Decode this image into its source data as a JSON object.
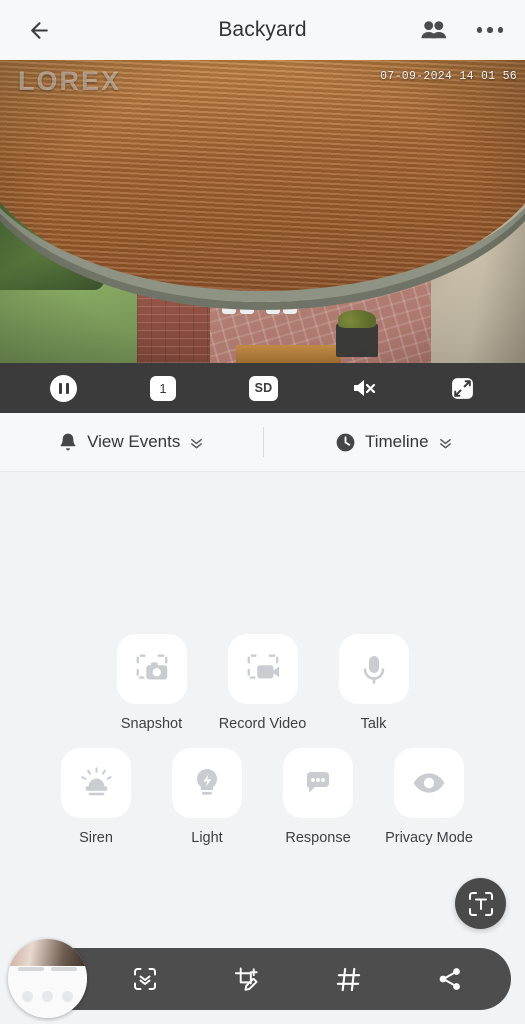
{
  "header": {
    "back_icon": "arrow-left-icon",
    "title": "Backyard",
    "people_icon": "people-icon",
    "more_icon": "more-options-icon"
  },
  "video": {
    "watermark": "LOREX",
    "timestamp": "07-09-2024 14 01 56",
    "scene_description": "Backyard patio fisheye camera view with two people"
  },
  "player_controls": {
    "pause_label": "Pause",
    "channel_label": "1",
    "quality_label": "SD",
    "mute_label": "Muted",
    "fullscreen_label": "Fullscreen"
  },
  "tabs": [
    {
      "label": "View Events",
      "icon": "bell-icon"
    },
    {
      "label": "Timeline",
      "icon": "clock-icon"
    }
  ],
  "actions": [
    [
      {
        "label": "Snapshot",
        "icon": "snapshot-icon"
      },
      {
        "label": "Record Video",
        "icon": "record-video-icon"
      },
      {
        "label": "Talk",
        "icon": "microphone-icon"
      }
    ],
    [
      {
        "label": "Siren",
        "icon": "siren-icon"
      },
      {
        "label": "Light",
        "icon": "light-bulb-icon"
      },
      {
        "label": "Response",
        "icon": "response-bubble-icon"
      },
      {
        "label": "Privacy Mode",
        "icon": "eye-icon"
      }
    ]
  ],
  "fab": {
    "icon": "text-scan-icon",
    "label": "Text scan"
  },
  "dock": {
    "thumbnail_label": "Screen preview",
    "buttons": [
      {
        "icon": "scan-chevron-icon",
        "label": "Scan"
      },
      {
        "icon": "annotate-icon",
        "label": "Annotate"
      },
      {
        "icon": "hashtag-icon",
        "label": "Hashtag"
      },
      {
        "icon": "share-icon",
        "label": "Share"
      }
    ]
  },
  "colors": {
    "page_background": "#f2f3f5",
    "header_background": "#f7f8f9",
    "control_bar": "#3b3b3b",
    "dock_background": "#4d4d4d",
    "tile_background": "#ffffff",
    "icon_gray": "#c9ccd1",
    "text_primary": "#33363a"
  }
}
